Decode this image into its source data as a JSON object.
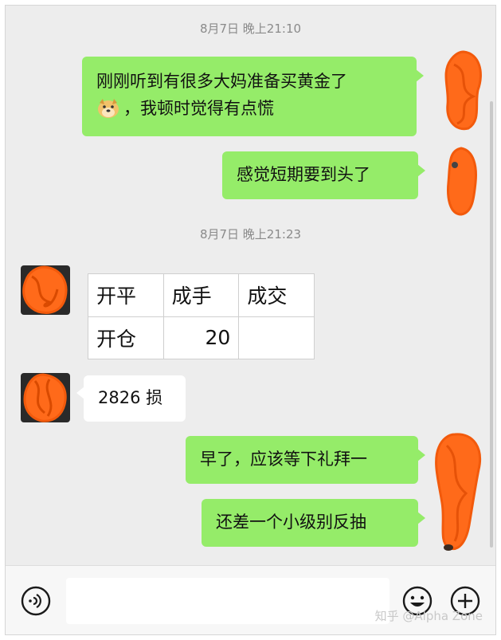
{
  "chat": {
    "timestamp_1": "8月7日 晚上21:10",
    "msg_1_line_1": "刚刚听到有很多大妈准备买黄金了",
    "msg_1_line_2": "，我顿时觉得有点慌",
    "msg_2": "感觉短期要到头了",
    "timestamp_2": "8月7日 晚上21:23",
    "image_table": {
      "headers": [
        "开平",
        "成手",
        "成交"
      ],
      "row": [
        "开仓",
        "20",
        ""
      ]
    },
    "msg_4": "2826 损",
    "msg_5": "早了，应该等下礼拜一",
    "msg_6": "还差一个小级别反抽"
  },
  "input_bar": {
    "voice_icon": "voice-icon",
    "emoji_icon": "emoji-icon",
    "plus_icon": "plus-icon"
  },
  "watermark": "知乎 @Alpha Zone",
  "colors": {
    "my_bubble": "#95ec69",
    "their_bubble": "#ffffff",
    "background": "#ededed",
    "scribble": "#ff6a1a"
  }
}
